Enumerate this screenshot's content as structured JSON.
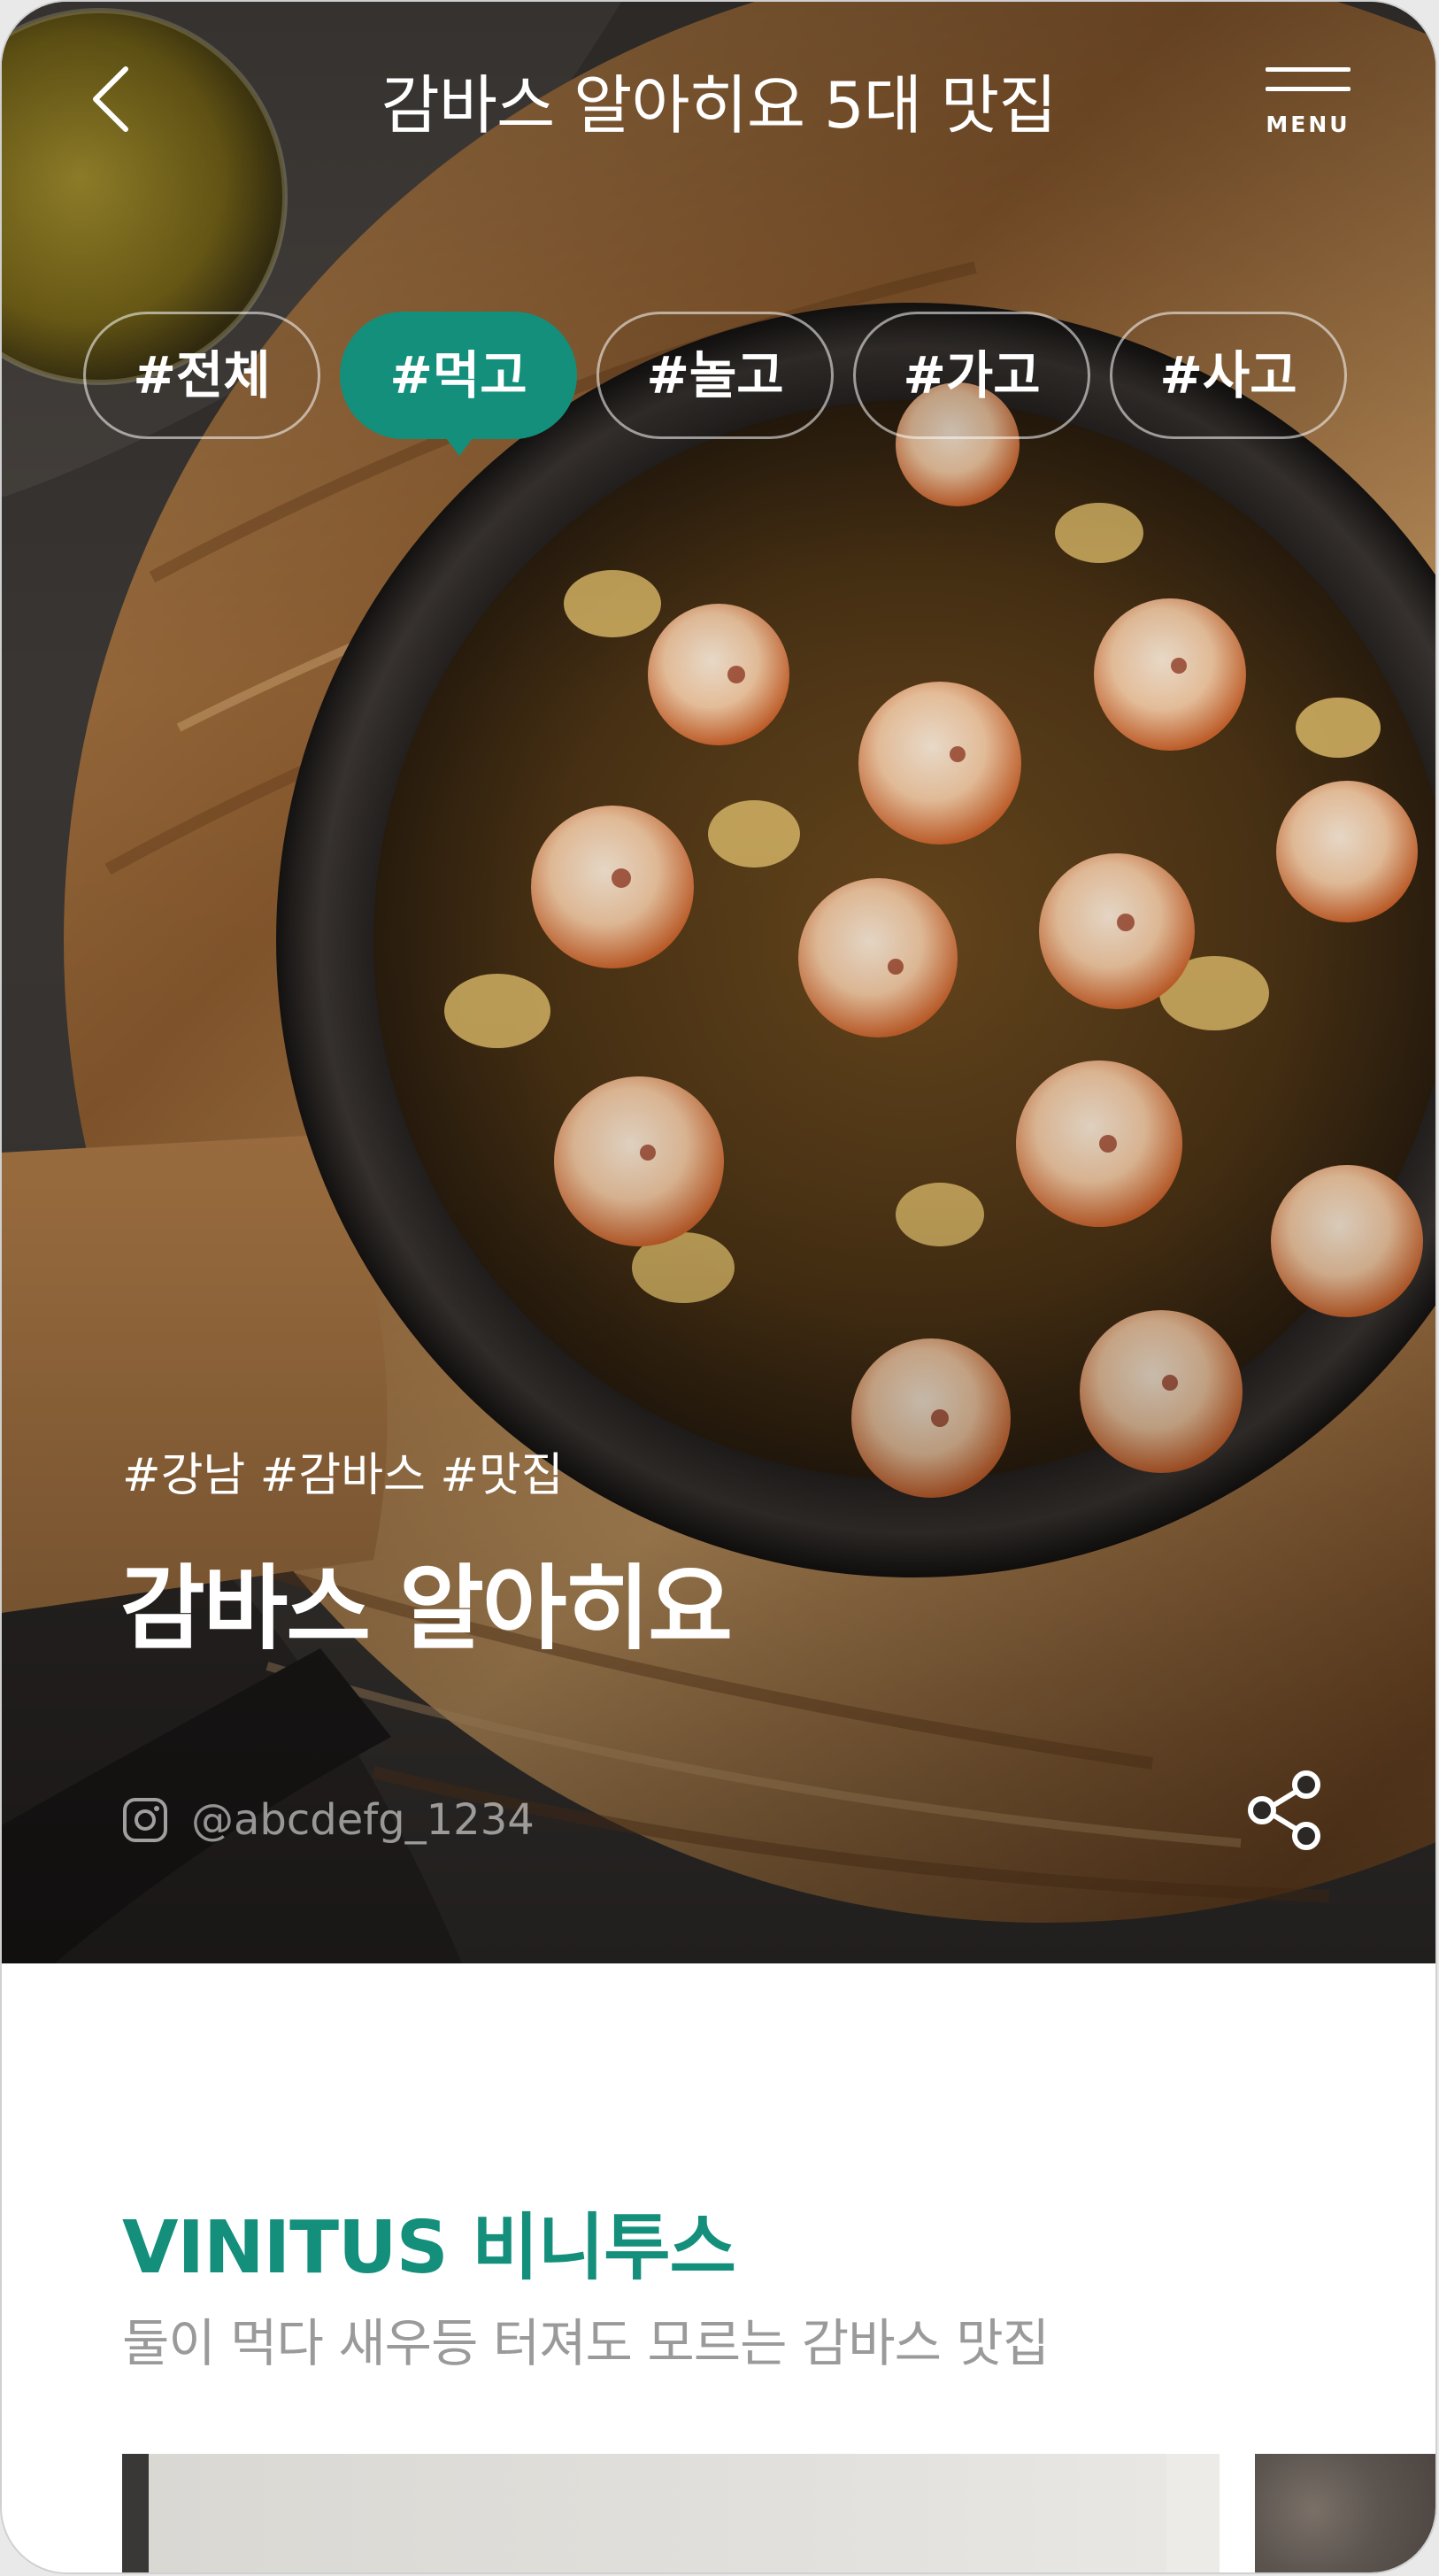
{
  "header": {
    "title": "감바스 알아히요 5대 맛집",
    "menu_label": "MENU"
  },
  "tabs": [
    {
      "label": "#전체",
      "active": false
    },
    {
      "label": "#먹고",
      "active": true
    },
    {
      "label": "#놀고",
      "active": false
    },
    {
      "label": "#가고",
      "active": false
    },
    {
      "label": "#사고",
      "active": false
    }
  ],
  "hero": {
    "hashtags": "#강남 #감바스 #맛집",
    "store_name": "감바스 알아히요",
    "instagram_handle": "@abcdefg_1234",
    "image_description_icon": "shrimp-gambas-photo"
  },
  "section": {
    "title": "VINITUS 비니투스",
    "subtitle": "둘이 먹다 새우등 터져도 모르는 감바스 맛집"
  },
  "colors": {
    "accent": "#138f7c",
    "text_light": "#ffffff",
    "text_muted": "#9a9a9a"
  },
  "icons": {
    "back": "chevron-left-icon",
    "menu": "hamburger-icon",
    "instagram": "instagram-icon",
    "share": "share-icon"
  }
}
